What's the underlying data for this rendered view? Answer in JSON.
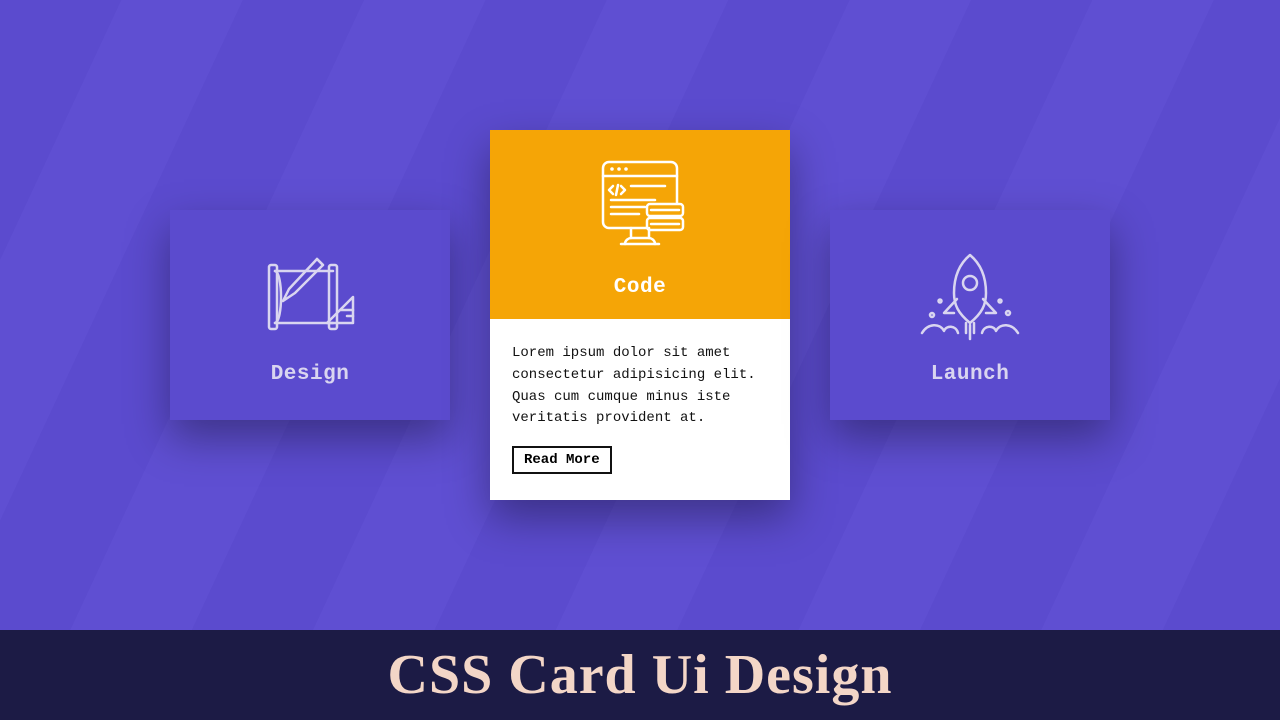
{
  "cards": [
    {
      "title": "Design"
    },
    {
      "title": "Code",
      "description": "Lorem ipsum dolor sit amet consectetur adipisicing elit. Quas cum cumque minus iste veritatis provident at.",
      "button": "Read More"
    },
    {
      "title": "Launch"
    }
  ],
  "footer": {
    "title": "CSS Card Ui Design"
  },
  "colors": {
    "background": "#5b4bce",
    "accent": "#f5a506",
    "footer": "#1c1b45",
    "footerText": "#f3d6c7"
  }
}
